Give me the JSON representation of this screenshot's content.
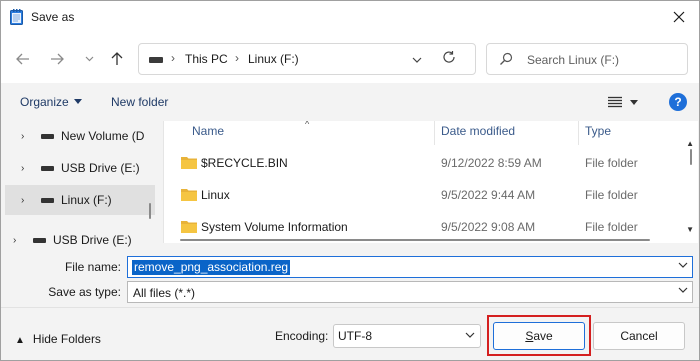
{
  "window": {
    "title": "Save as"
  },
  "address": {
    "items": [
      "This PC",
      "Linux (F:)"
    ]
  },
  "search": {
    "placeholder": "Search Linux (F:)"
  },
  "commands": {
    "organize": "Organize",
    "new_folder": "New folder"
  },
  "nav_tree": [
    {
      "label": "New Volume (D"
    },
    {
      "label": "USB Drive (E:)"
    },
    {
      "label": "Linux (F:)"
    },
    {
      "label": "USB Drive (E:)"
    }
  ],
  "columns": {
    "name": "Name",
    "date": "Date modified",
    "type": "Type"
  },
  "files": [
    {
      "name": "$RECYCLE.BIN",
      "date": "9/12/2022 8:59 AM",
      "type": "File folder"
    },
    {
      "name": "Linux",
      "date": "9/5/2022 9:44 AM",
      "type": "File folder"
    },
    {
      "name": "System Volume Information",
      "date": "9/5/2022 9:08 AM",
      "type": "File folder"
    }
  ],
  "form": {
    "filename_label": "File name:",
    "filename_value": "remove_png_association.reg",
    "type_label": "Save as type:",
    "type_value": "All files  (*.*)"
  },
  "bottom": {
    "hide_folders": "Hide Folders",
    "encoding_label": "Encoding:",
    "encoding_value": "UTF-8",
    "save_rest": "ave",
    "save_mnemonic": "S",
    "cancel": "Cancel"
  },
  "colors": {
    "accent": "#1e6fd9",
    "selection": "#0a64c8",
    "highlight_box": "#d41f1f",
    "folder": "#f5c542"
  }
}
